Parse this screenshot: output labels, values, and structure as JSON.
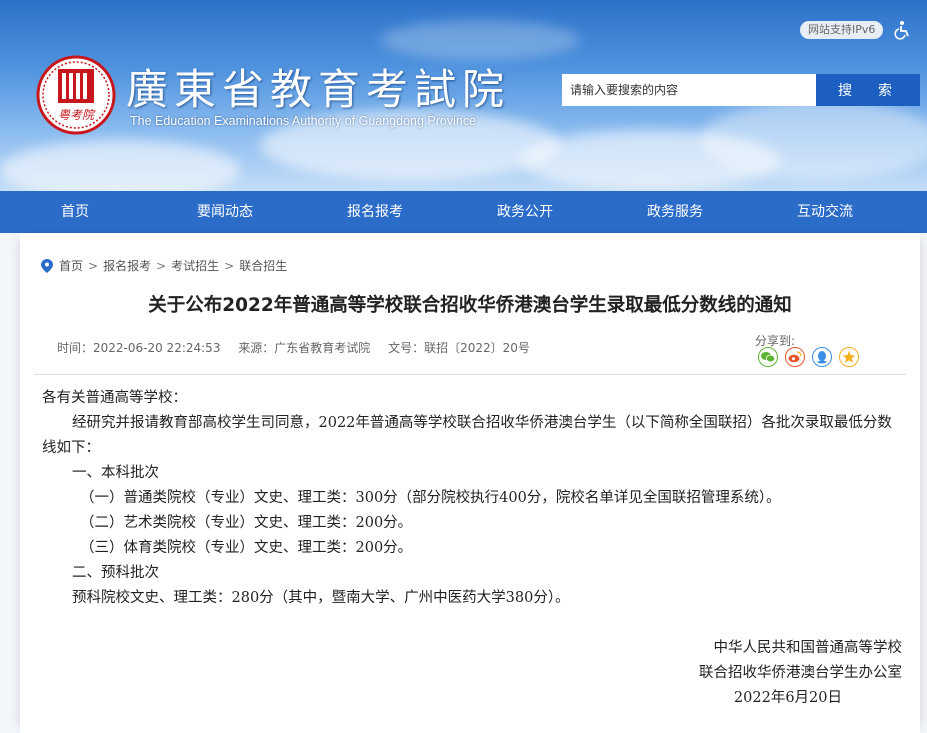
{
  "header": {
    "site_title": "廣東省教育考試院",
    "site_subtitle": "The Education Examinations Authority of Guangdong Province",
    "emblem_text": "粤考院",
    "ipv6_badge": "网站支持IPv6",
    "search_placeholder": "请输入要搜索的内容",
    "search_button": "搜　索"
  },
  "nav": {
    "items": [
      "首页",
      "要闻动态",
      "报名报考",
      "政务公开",
      "政务服务",
      "互动交流"
    ]
  },
  "breadcrumb": [
    "首页",
    "报名报考",
    "考试招生",
    "联合招生"
  ],
  "breadcrumb_separator": ">",
  "article": {
    "title": "关于公布2022年普通高等学校联合招收华侨港澳台学生录取最低分数线的通知",
    "time": "时间：2022-06-20 22:24:53",
    "source": "来源：广东省教育考试院",
    "doc_no": "文号：联招〔2022〕20号",
    "share_label": "分享到:",
    "paragraphs": {
      "p1": "各有关普通高等学校：",
      "p2": "经研究并报请教育部高校学生司同意，2022年普通高等学校联合招收华侨港澳台学生（以下简称全国联招）各批次录取最低分数线如下：",
      "p3": "一、本科批次",
      "p4": "（一）普通类院校（专业）文史、理工类：300分（部分院校执行400分，院校名单详见全国联招管理系统）。",
      "p5": "（二）艺术类院校（专业）文史、理工类：200分。",
      "p6": "（三）体育类院校（专业）文史、理工类：200分。",
      "p7": "二、预科批次",
      "p8": "预科院校文史、理工类：280分（其中，暨南大学、广州中医药大学380分）。"
    },
    "signature_1": "中华人民共和国普通高等学校",
    "signature_2": "联合招收华侨港澳台学生办公室",
    "signature_date": "2022年6月20日"
  },
  "colors": {
    "nav_bg": "#2b6cc9",
    "search_button_bg": "#1d5fc0",
    "emblem_red": "#c8161d",
    "wechat_green": "#5bb532",
    "weibo_orange": "#e8542c",
    "qq_blue": "#3a8ee6",
    "qzone_yellow": "#f2b01e"
  },
  "icons": {
    "location": "map-pin-icon",
    "wechat": "wechat-icon",
    "weibo": "weibo-icon",
    "qq": "qq-icon",
    "qzone": "qzone-icon",
    "accessibility": "wheelchair-icon"
  }
}
